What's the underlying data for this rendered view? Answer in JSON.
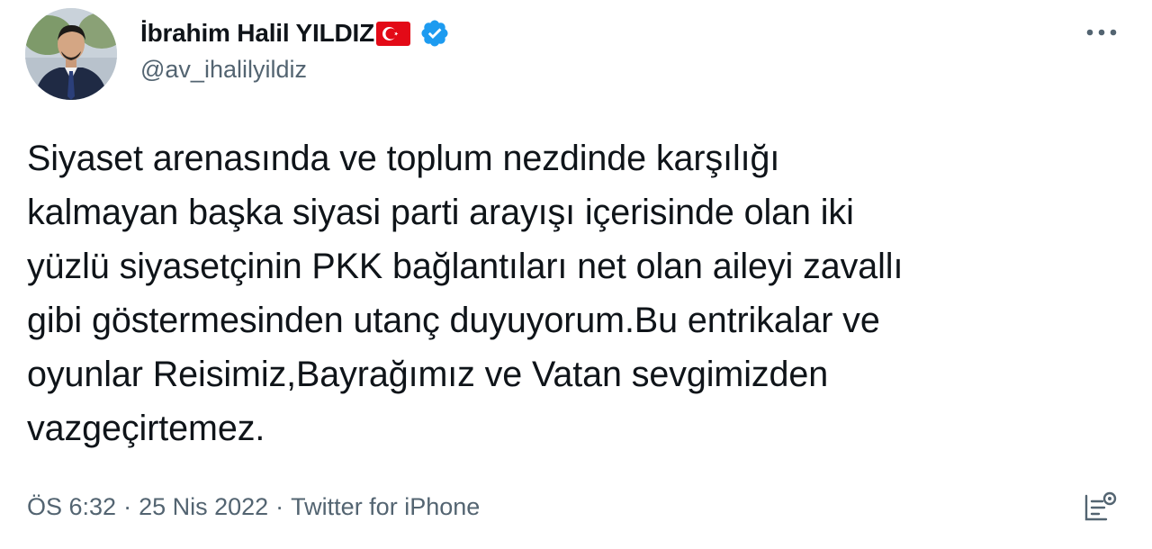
{
  "author": {
    "display_name": "İbrahim Halil YILDIZ",
    "handle": "@av_ihalilyildiz",
    "flag_icon": "turkey-flag-icon",
    "verified_icon": "verified-badge-icon",
    "verified_color": "#1d9bf0"
  },
  "tweet": {
    "lines": [
      "Siyaset arenasında ve toplum nezdinde karşılığı",
      "kalmayan başka siyasi parti arayışı içerisinde olan iki",
      "yüzlü siyasetçinin PKK bağlantıları net olan aileyi zavallı",
      "gibi göstermesinden utanç duyuyorum.Bu entrikalar ve",
      "oyunlar Reisimiz,Bayrağımız ve Vatan sevgimizden",
      "vazgeçirtemez."
    ]
  },
  "meta": {
    "time": "ÖS 6:32",
    "separator": "·",
    "date": "25 Nis 2022",
    "source": "Twitter for iPhone"
  },
  "icons": {
    "more": "more-horizontal-icon",
    "analytics": "analytics-icon"
  },
  "colors": {
    "text": "#0f1419",
    "secondary": "#536471",
    "flag_red": "#e30a17"
  }
}
